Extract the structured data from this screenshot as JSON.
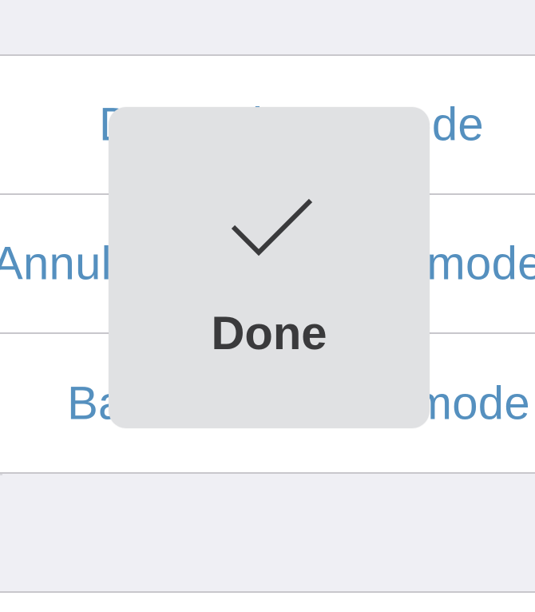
{
  "menu": {
    "items": [
      {
        "label": "Determinate mode"
      },
      {
        "label": "Annular determinate mode"
      },
      {
        "label": "Bar determinate mode"
      }
    ]
  },
  "hud": {
    "icon": "checkmark-icon",
    "label": "Done",
    "colors": {
      "background": "#e0e1e3",
      "text": "#3a3a3c"
    }
  },
  "colors": {
    "link": "#5590bf",
    "separator": "#c8c7cc",
    "group_background": "#efeff4"
  }
}
